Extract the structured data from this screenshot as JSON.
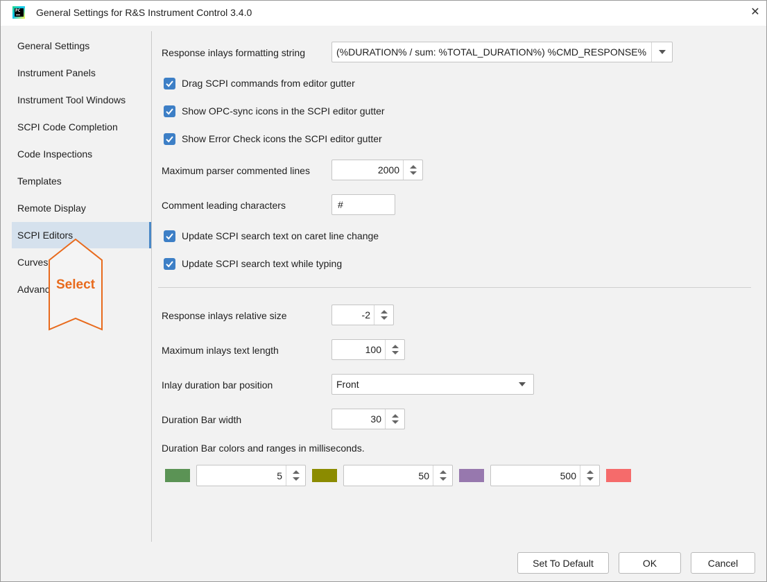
{
  "window": {
    "title": "General Settings for R&S Instrument Control 3.4.0",
    "app_icon_text": "PC"
  },
  "sidebar": {
    "items": [
      {
        "label": "General Settings"
      },
      {
        "label": "Instrument Panels"
      },
      {
        "label": "Instrument Tool Windows"
      },
      {
        "label": "SCPI Code Completion"
      },
      {
        "label": "Code Inspections"
      },
      {
        "label": "Templates"
      },
      {
        "label": "Remote Display"
      },
      {
        "label": "SCPI Editors",
        "selected": true
      },
      {
        "label": "Curves"
      },
      {
        "label": "Advanced"
      }
    ],
    "callout_label": "Select"
  },
  "settings": {
    "response_inlays_format": {
      "label": "Response inlays formatting string",
      "value": "(%DURATION% / sum: %TOTAL_DURATION%) %CMD_RESPONSE%"
    },
    "drag_scpi": {
      "label": "Drag SCPI commands from editor gutter",
      "checked": true
    },
    "opc_sync_icons": {
      "label": "Show OPC-sync icons in the SCPI editor gutter",
      "checked": true
    },
    "error_check_icons": {
      "label": "Show Error Check icons the SCPI editor gutter",
      "checked": true
    },
    "max_parser_lines": {
      "label": "Maximum parser commented lines",
      "value": "2000"
    },
    "comment_chars": {
      "label": "Comment leading characters",
      "value": "#"
    },
    "update_search_caret": {
      "label": "Update SCPI search text on caret line change",
      "checked": true
    },
    "update_search_typing": {
      "label": "Update SCPI search text while typing",
      "checked": true
    },
    "inlays_relative_size": {
      "label": "Response inlays relative size",
      "value": "-2"
    },
    "max_inlays_length": {
      "label": "Maximum inlays text length",
      "value": "100"
    },
    "duration_bar_position": {
      "label": "Inlay duration bar position",
      "value": "Front"
    },
    "duration_bar_width": {
      "label": "Duration Bar width",
      "value": "30"
    },
    "duration_colors": {
      "label": "Duration Bar colors and ranges in milliseconds.",
      "colors": [
        "#5b9355",
        "#8b8b00",
        "#9778ae",
        "#f56b6b"
      ],
      "ranges": [
        "5",
        "50",
        "500"
      ]
    }
  },
  "buttons": {
    "set_default": "Set To Default",
    "ok": "OK",
    "cancel": "Cancel"
  }
}
